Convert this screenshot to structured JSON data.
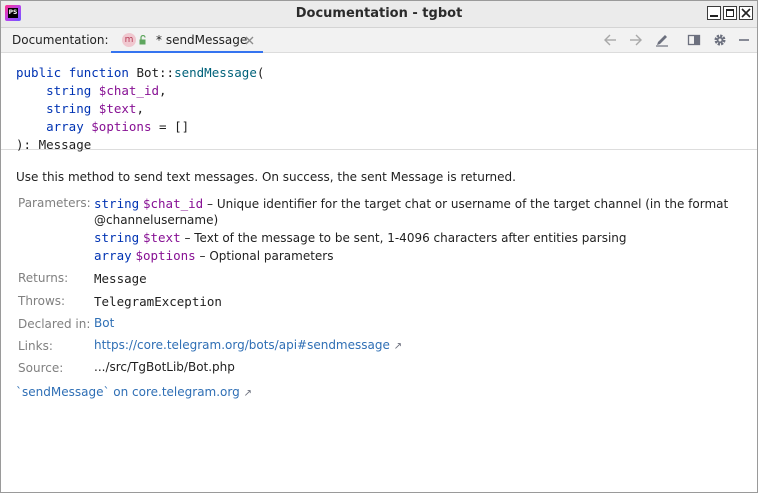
{
  "window": {
    "title": "Documentation - tgbot",
    "app_icon_label": "PS",
    "controls": [
      "minimize",
      "maximize",
      "close"
    ]
  },
  "toolbar": {
    "label": "Documentation:",
    "tab": {
      "badge": "m",
      "title": "* sendMessage"
    },
    "icons": [
      "back-arrow-icon",
      "forward-arrow-icon",
      "edit-source-icon",
      "open-in-window-icon",
      "gear-icon",
      "minimize-panel-icon"
    ]
  },
  "signature": {
    "line1": {
      "kw1": "public",
      "kw2": "function",
      "class": "Bot::",
      "fn": "sendMessage",
      "paren": "("
    },
    "params": [
      {
        "type": "string",
        "var": "$chat_id",
        "suffix": ","
      },
      {
        "type": "string",
        "var": "$text",
        "suffix": ","
      },
      {
        "type": "array",
        "var": "$options",
        "suffix": " = []"
      }
    ],
    "return_line": "): Message"
  },
  "description": "Use this method to send text messages. On success, the sent Message is returned.",
  "sections": {
    "parameters": {
      "label": "Parameters:",
      "items": [
        {
          "type": "string",
          "var": "$chat_id",
          "text": " – Unique identifier for the target chat or username of the target channel (in the format",
          "continuation": "@channelusername)"
        },
        {
          "type": "string",
          "var": "$text",
          "text": " – Text of the message to be sent, 1-4096 characters after entities parsing"
        },
        {
          "type": "array",
          "var": "$options",
          "text": " – Optional parameters"
        }
      ]
    },
    "returns": {
      "label": "Returns:",
      "value": "Message"
    },
    "throws": {
      "label": "Throws:",
      "value": "TelegramException"
    },
    "declared_in": {
      "label": "Declared in:",
      "value": "Bot"
    },
    "links": {
      "label": "Links:",
      "value": "https://core.telegram.org/bots/api#sendmessage",
      "arrow": "↗"
    },
    "source": {
      "label": "Source:",
      "value": ".../src/TgBotLib/Bot.php"
    }
  },
  "external_link": {
    "text": "`sendMessage` on core.telegram.org",
    "arrow": "↗"
  },
  "colors": {
    "keyword": "#0033b3",
    "function": "#00627a",
    "variable": "#871094",
    "link": "#2f6fb5",
    "accent_tab": "#3574f0"
  }
}
